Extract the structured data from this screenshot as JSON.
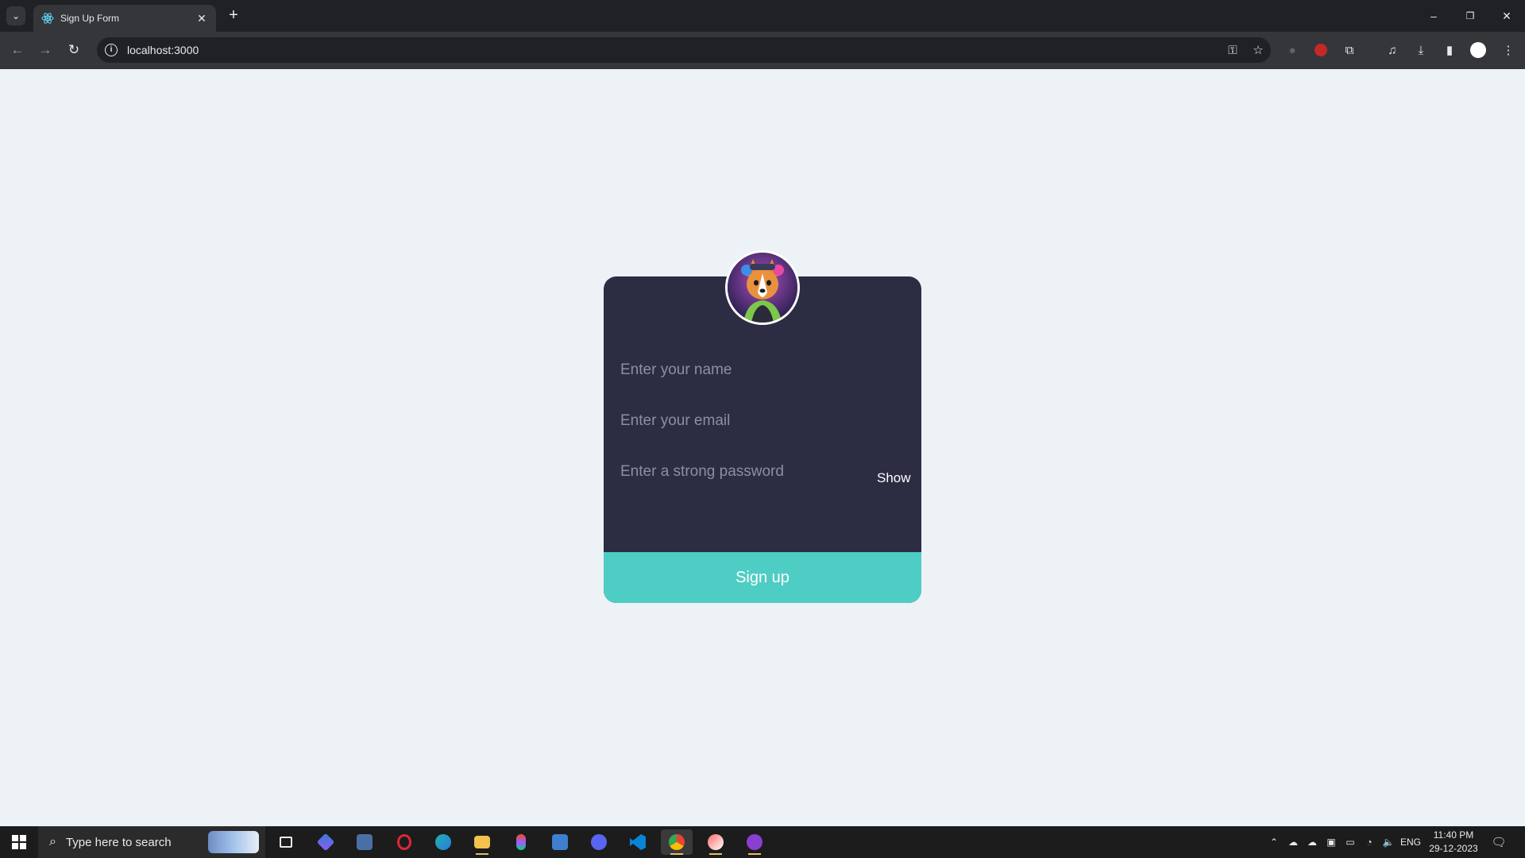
{
  "browser": {
    "tab_title": "Sign Up Form",
    "new_tab": "+",
    "url": "localhost:3000",
    "window_controls": {
      "minimize": "–",
      "restore": "❐",
      "close": "✕"
    }
  },
  "form": {
    "name_placeholder": "Enter your name",
    "email_placeholder": "Enter your email",
    "password_placeholder": "Enter a strong password",
    "show_label": "Show",
    "submit_label": "Sign up",
    "colors": {
      "card": "#2c2c42",
      "button": "#4ecdc4",
      "page": "#edf2f6"
    }
  },
  "taskbar": {
    "search_placeholder": "Type here to search",
    "language": "ENG",
    "time": "11:40 PM",
    "date": "29-12-2023",
    "apps": [
      "task-view",
      "copilot",
      "calculator",
      "opera",
      "edge",
      "file-explorer",
      "figma",
      "remote-desktop",
      "discord",
      "vscode",
      "chrome",
      "meteor",
      "github-desktop"
    ]
  }
}
